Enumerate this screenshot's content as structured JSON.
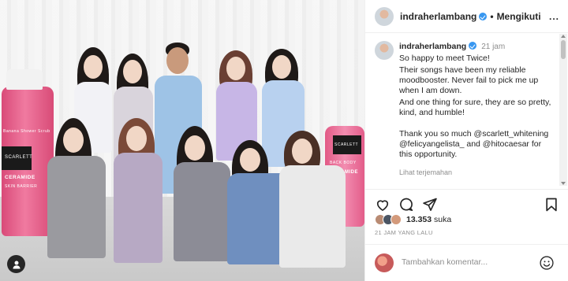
{
  "photo": {
    "bottle_left_label": {
      "brand": "SCARLETT",
      "line1": "Banana Shower Scrub",
      "line2": "CERAMIDE",
      "line3": "SKIN BARRIER"
    },
    "bottle_right_label": {
      "brand": "SCARLETT",
      "line1": "BACK BODY",
      "line2": "CERAMIDE"
    },
    "corner_icon": "user-avatar-icon"
  },
  "header": {
    "username": "indraherlambang",
    "separator": "•",
    "follow_label": "Mengikuti",
    "more_label": "..."
  },
  "comment": {
    "username": "indraherlambang",
    "time": "21 jam",
    "lines": [
      "So happy to meet Twice!",
      "Their songs have been my reliable moodbooster. Never fail to pick me up when I am down.",
      "And one thing for sure, they are so pretty, kind, and humble!",
      "",
      "Thank you so much @scarlett_whitening @felicyangelista_ and @hitocaesar for this opportunity."
    ],
    "translate_label": "Lihat terjemahan"
  },
  "actions": {
    "icons": [
      "heart-icon",
      "comment-icon",
      "share-icon",
      "bookmark-icon"
    ]
  },
  "likes": {
    "count": "13.353",
    "suffix": "suka"
  },
  "post_date": "21 JAM YANG LALU",
  "add_comment": {
    "placeholder": "Tambahkan komentar...",
    "emoji_icon": "emoji-icon"
  },
  "colors": {
    "verified": "#3897f0",
    "bottle_pink": "#e8638f",
    "text_primary": "#262626",
    "text_secondary": "#8e8e8e"
  }
}
